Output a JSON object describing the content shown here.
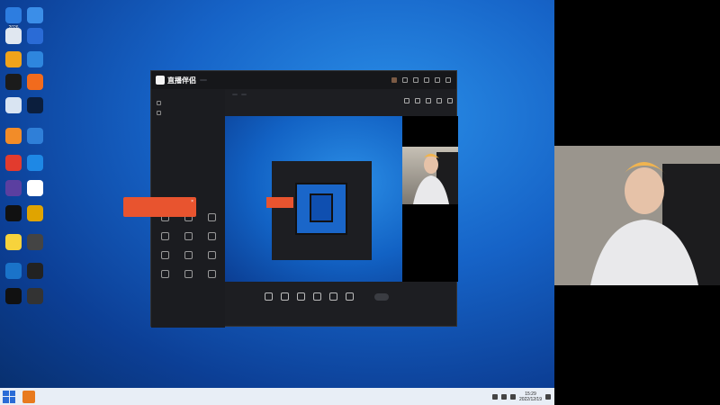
{
  "desktop": {
    "icons": [
      {
        "label": "2026",
        "color": "#2d7de0"
      },
      {
        "label": "",
        "color": "#3b8ee8"
      },
      {
        "label": "",
        "color": "#e0e7f0"
      },
      {
        "label": "",
        "color": "#2a6bd6"
      },
      {
        "label": "",
        "color": "#f0a31a"
      },
      {
        "label": "",
        "color": "#2e86de"
      },
      {
        "label": "",
        "color": "#1b1b1b"
      },
      {
        "label": "",
        "color": "#f26b1d"
      },
      {
        "label": "",
        "color": "#d9e4f2"
      },
      {
        "label": "",
        "color": "#0b1e3d"
      },
      {
        "label": "",
        "color": "#f28c28"
      },
      {
        "label": "",
        "color": "#2f7fd8"
      },
      {
        "label": "",
        "color": "#e23b2e"
      },
      {
        "label": "",
        "color": "#1e88e5"
      },
      {
        "label": "",
        "color": "#5b3fa0"
      },
      {
        "label": "",
        "color": "#ffffff"
      },
      {
        "label": "",
        "color": "#111111"
      },
      {
        "label": "",
        "color": "#e0a400"
      },
      {
        "label": "",
        "color": "#f7d33c"
      },
      {
        "label": "",
        "color": "#444444"
      },
      {
        "label": "",
        "color": "#1a73c9"
      },
      {
        "label": "",
        "color": "#222222"
      },
      {
        "label": "",
        "color": "#111111"
      },
      {
        "label": "",
        "color": "#333333"
      }
    ]
  },
  "taskbar": {
    "time": "15:29",
    "date": "2022/12/19"
  },
  "app": {
    "name": "直播伴侣",
    "version": "",
    "side_tabs": [
      "",
      "",
      ""
    ],
    "scenes": [
      "",
      ""
    ],
    "tools": [
      "",
      "",
      "",
      "",
      "",
      "",
      "",
      "",
      "",
      "",
      "",
      ""
    ],
    "room_title": "",
    "room_tags": [
      "",
      ""
    ],
    "room_sub": [
      "",
      "",
      "",
      ""
    ],
    "controls": [
      "",
      "",
      "",
      "",
      "",
      ""
    ],
    "start_live": "",
    "notice": "",
    "status": [
      "",
      "",
      "",
      "",
      ""
    ]
  }
}
